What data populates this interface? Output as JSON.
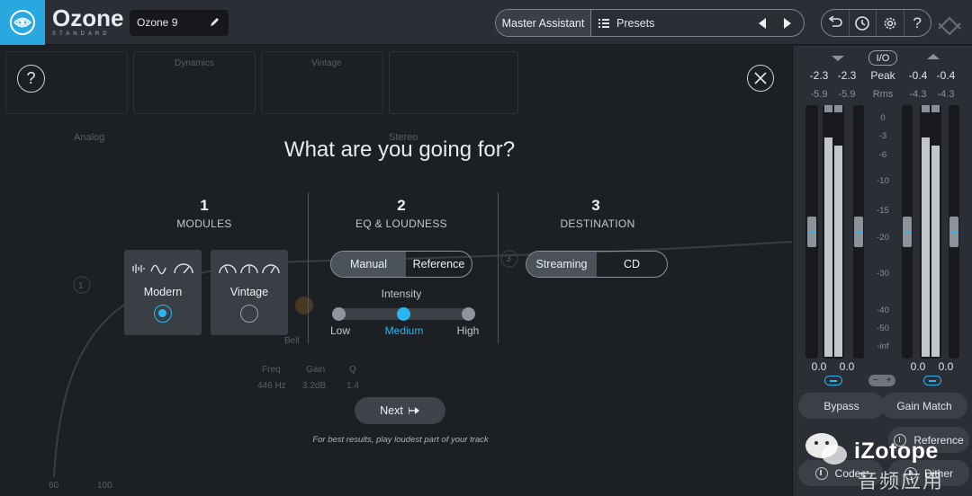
{
  "header": {
    "brand_name": "Ozone",
    "brand_sub": "STANDARD",
    "preset_name": "Ozone 9",
    "master_assistant_label": "Master Assistant",
    "presets_label": "Presets"
  },
  "workspace_ghost": {
    "mode_label": "Analog",
    "stereo_label": "Stereo",
    "dynamics_label": "Dynamics",
    "vintage_label": "Vintage",
    "band_1": "1",
    "band_3": "3",
    "bell_label": "Bell",
    "freq_label": "Freq",
    "gain_label": "Gain",
    "q_label": "Q",
    "freq_value": "446 Hz",
    "gain_value": "3.2dB",
    "q_value": "1.4",
    "x_100": "100",
    "x_60": "60"
  },
  "overlay": {
    "heading": "What are you going for?",
    "steps": [
      {
        "number": "1",
        "label": "MODULES"
      },
      {
        "number": "2",
        "label": "EQ & LOUDNESS"
      },
      {
        "number": "3",
        "label": "DESTINATION"
      }
    ],
    "modules": [
      {
        "label": "Modern",
        "selected": true
      },
      {
        "label": "Vintage",
        "selected": false
      }
    ],
    "eq_modes": [
      {
        "label": "Manual",
        "selected": true
      },
      {
        "label": "Reference",
        "selected": false
      }
    ],
    "intensity": {
      "label": "Intensity",
      "options": [
        "Low",
        "Medium",
        "High"
      ],
      "selected": "Medium"
    },
    "destinations": [
      {
        "label": "Streaming",
        "selected": true
      },
      {
        "label": "CD",
        "selected": false
      }
    ],
    "next_label": "Next",
    "tip": "For best results, play loudest part of your track"
  },
  "meters": {
    "io_label": "I/O",
    "peak_label": "Peak",
    "rms_label": "Rms",
    "in_peak": [
      "-2.3",
      "-2.3"
    ],
    "in_rms": [
      "-5.9",
      "-5.9"
    ],
    "out_peak": [
      "-0.4",
      "-0.4"
    ],
    "out_rms": [
      "-4.3",
      "-4.3"
    ],
    "scale": [
      "0",
      "-3",
      "-6",
      "-10",
      "-15",
      "-20",
      "-30",
      "-40",
      "-50",
      "-inf"
    ],
    "in_fader": [
      "0.0",
      "0.0"
    ],
    "out_fader": [
      "0.0",
      "0.0"
    ],
    "bypass_label": "Bypass",
    "gain_match_label": "Gain Match",
    "reference_label": "Reference",
    "codec_label": "Codec",
    "dither_label": "Dither"
  },
  "watermark": {
    "text": "iZotope",
    "cn": "音频应用"
  },
  "colors": {
    "accent": "#29b5f0",
    "logo_bg": "#29a8e0"
  }
}
